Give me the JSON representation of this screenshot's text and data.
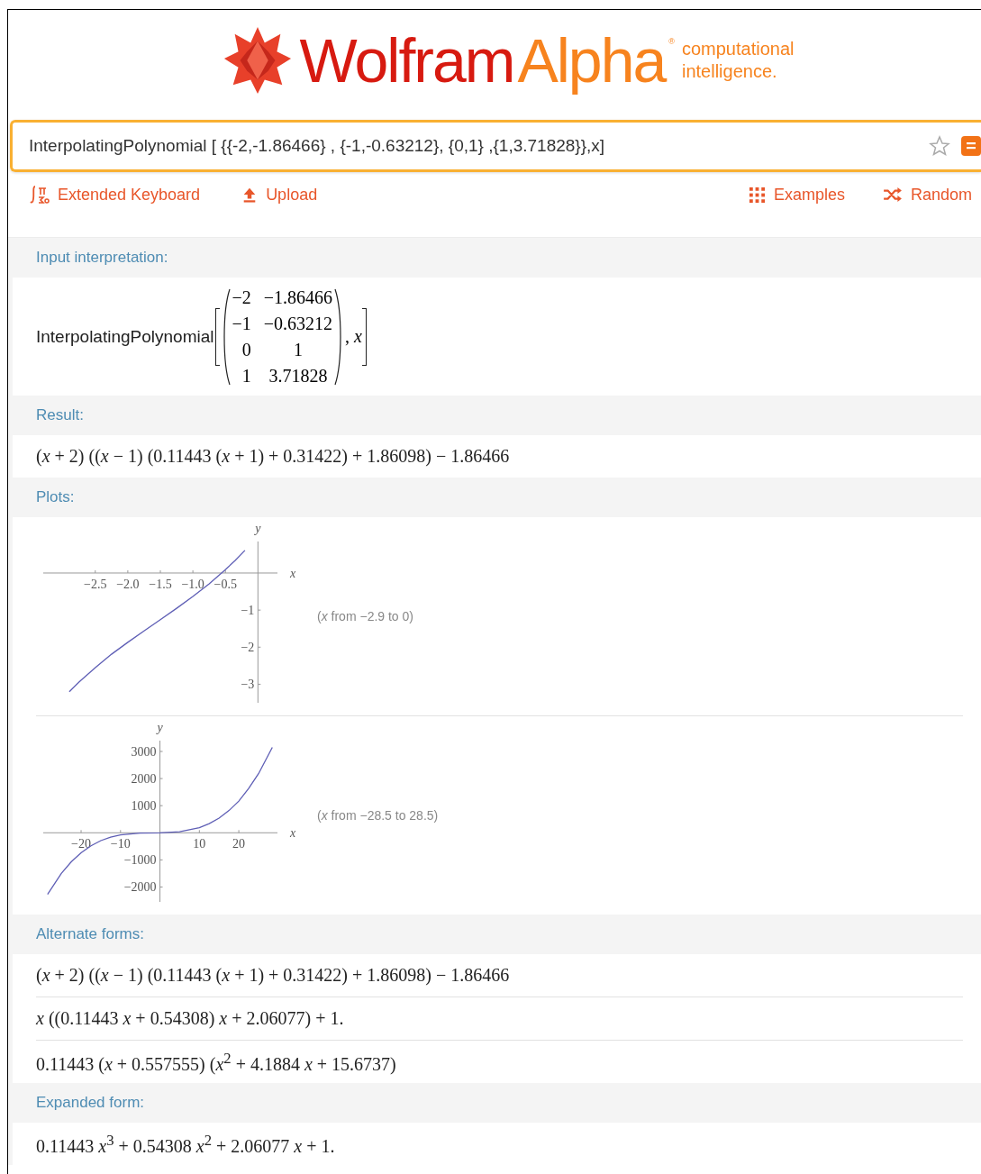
{
  "logo": {
    "word_1": "Wolfram",
    "word_2": "Alpha",
    "registered_mark": "®",
    "tagline_1": "computational",
    "tagline_2": "intelligence."
  },
  "search": {
    "value": "InterpolatingPolynomial [ {{-2,-1.86466} , {-1,-0.63212}, {0,1} ,{1,3.71828}},x]"
  },
  "toolbar": {
    "left": [
      {
        "kind": "keyboard",
        "label": "Extended Keyboard"
      },
      {
        "kind": "upload",
        "label": "Upload"
      }
    ],
    "right": [
      {
        "kind": "examples",
        "label": "Examples"
      },
      {
        "kind": "random",
        "label": "Random"
      }
    ]
  },
  "pods": [
    {
      "kind": "matrix",
      "title": "Input interpretation:",
      "function": "InterpolatingPolynomial",
      "rows": [
        [
          "−2",
          "−1.86466"
        ],
        [
          "−1",
          "−0.63212"
        ],
        [
          "0",
          "1"
        ],
        [
          "1",
          "3.71828"
        ]
      ],
      "argument": ", *x*"
    },
    {
      "kind": "formulas",
      "title": "Result:",
      "lines": [
        "(*x* + 2) ((*x* − 1) (0.11443 (*x* + 1) + 0.31422) + 1.86098) − 1.86466"
      ]
    },
    {
      "kind": "plots",
      "title": "Plots:",
      "plots": [
        {
          "caption": "(*x* from −2.9 to 0)",
          "chart_data": {
            "type": "line",
            "xlabel": "x",
            "ylabel": "y",
            "xlim": [
              -3.3,
              0.3
            ],
            "ylim": [
              -3.5,
              0.85
            ],
            "xticks": [
              {
                "value": -2.5,
                "label": "−2.5"
              },
              {
                "value": -2,
                "label": "−2.0"
              },
              {
                "value": -1.5,
                "label": "−1.5"
              },
              {
                "value": -1,
                "label": "−1.0"
              },
              {
                "value": -0.5,
                "label": "−0.5"
              }
            ],
            "yticks": [
              {
                "value": -1,
                "label": "−1"
              },
              {
                "value": -2,
                "label": "−2"
              },
              {
                "value": -3,
                "label": "−3"
              }
            ],
            "x": [
              -2.9,
              -2.75,
              -2.5,
              -2.25,
              -2,
              -1.75,
              -1.5,
              -1.25,
              -1,
              -0.75,
              -0.5,
              -0.35,
              -0.2
            ],
            "series": [
              {
                "color": "#5e5eb5",
                "values": [
                  -3.2,
                  -2.94,
                  -2.55,
                  -2.19,
                  -1.87,
                  -1.56,
                  -1.26,
                  -0.95,
                  -0.63,
                  -0.29,
                  0.09,
                  0.34,
                  0.61
                ]
              }
            ]
          }
        },
        {
          "caption": "(*x* from −28.5 to 28.5)",
          "chart_data": {
            "type": "line",
            "xlabel": "x",
            "ylabel": "y",
            "xlim": [
              -29.6,
              29.8
            ],
            "ylim": [
              -2550,
              3400
            ],
            "xticks": [
              {
                "value": -20,
                "label": "−20"
              },
              {
                "value": -10,
                "label": "−10"
              },
              {
                "value": 10,
                "label": "10"
              },
              {
                "value": 20,
                "label": "20"
              }
            ],
            "yticks": [
              {
                "value": 3000,
                "label": "3000"
              },
              {
                "value": 2000,
                "label": "2000"
              },
              {
                "value": 1000,
                "label": "1000"
              },
              {
                "value": -1000,
                "label": "−1000"
              },
              {
                "value": -2000,
                "label": "−2000"
              }
            ],
            "x": [
              -28.5,
              -25,
              -22.5,
              -20,
              -17.5,
              -15,
              -12.5,
              -10,
              -5,
              0,
              5,
              10,
              12.5,
              15,
              17.5,
              20,
              22.5,
              25,
              28.5
            ],
            "series": [
              {
                "color": "#5e5eb5",
                "values": [
                  -2270,
                  -1500,
                  -1070,
                  -740,
                  -480,
                  -290,
                  -160,
                  -80,
                  -10,
                  0,
                  40,
                  190,
                  340,
                  540,
                  820,
                  1170,
                  1630,
                  2180,
                  3150
                ]
              }
            ]
          }
        }
      ]
    },
    {
      "kind": "formulas",
      "title": "Alternate forms:",
      "lines": [
        "(*x* + 2) ((*x* − 1) (0.11443 (*x* + 1) + 0.31422) + 1.86098) − 1.86466",
        "*x* ((0.11443 *x* + 0.54308) *x* + 2.06077) + 1.",
        "0.11443 (*x* + 0.557555) (*x*$^{2}$ + 4.1884 *x* + 15.6737)"
      ]
    },
    {
      "kind": "formulas",
      "title": "Expanded form:",
      "lines": [
        "0.11443 *x*$^{3}$ + 0.54308 *x*$^{2}$ + 2.06077 *x* + 1."
      ]
    }
  ]
}
